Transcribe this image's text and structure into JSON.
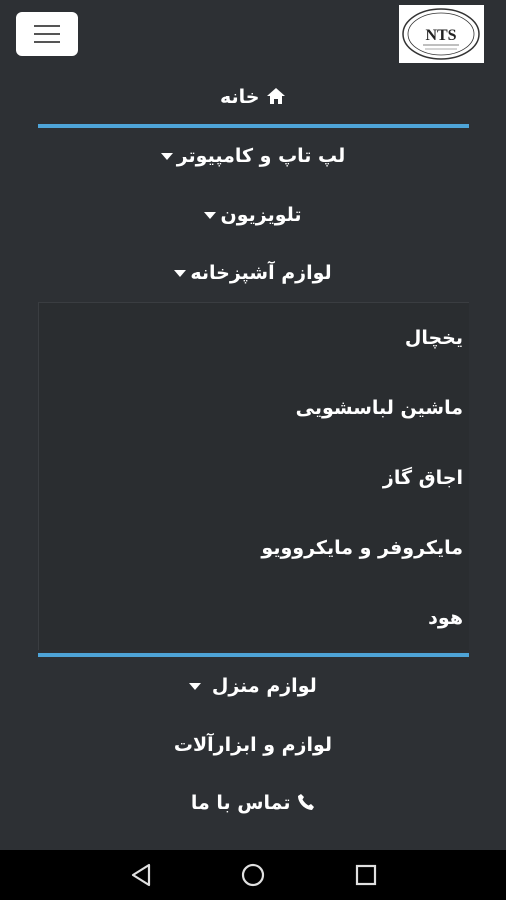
{
  "header": {
    "menu_icon": "hamburger-icon",
    "logo_text": "NTS"
  },
  "menu": {
    "home": "خانه",
    "home_icon": "home-icon",
    "laptop": "لپ تاپ و کامپیوتر",
    "tv": "تلویزیون",
    "kitchen": "لوازم آشپزخانه",
    "kitchen_sub": [
      "یخچال",
      "ماشین لباسشویی",
      "اجاق گاز",
      "مایکروفر و مایکروویو",
      "هود"
    ],
    "home_appliances": "لوازم منزل",
    "tools": "لوازم و ابزارآلات",
    "contact": "تماس با ما",
    "contact_icon": "phone-icon"
  },
  "colors": {
    "background": "#2d3034",
    "divider": "#4ea4d8",
    "navbar": "#000000"
  },
  "system_nav": {
    "back_icon": "back-triangle-icon",
    "home_icon": "home-circle-icon",
    "recents_icon": "recents-square-icon"
  }
}
